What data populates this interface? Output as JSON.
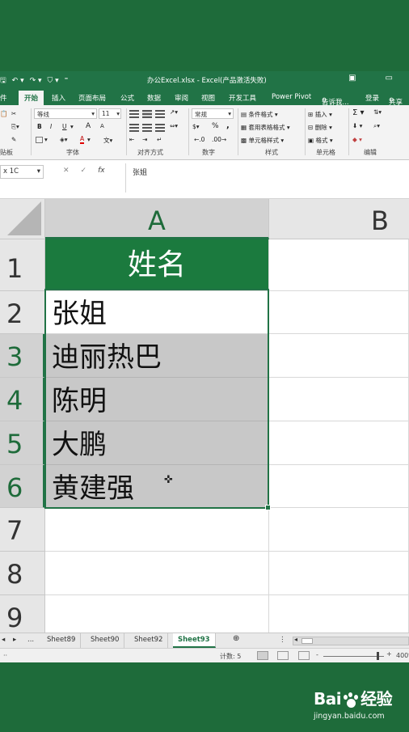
{
  "window": {
    "title": "办公Excel.xlsx - Excel(产品激活失败)",
    "restore_icon": "ribbon-display-icon",
    "minimize_icon": "minimize-icon"
  },
  "ribbon_tabs": [
    {
      "label": "件"
    },
    {
      "label": "开始",
      "active": true
    },
    {
      "label": "插入"
    },
    {
      "label": "页面布局"
    },
    {
      "label": "公式"
    },
    {
      "label": "数据"
    },
    {
      "label": "审阅"
    },
    {
      "label": "视图"
    },
    {
      "label": "开发工具"
    },
    {
      "label": "Power Pivot"
    },
    {
      "label": "告诉我..."
    },
    {
      "label": "登录"
    },
    {
      "label": "共享"
    }
  ],
  "ribbon": {
    "font_name": "等线",
    "font_size": "11",
    "number_format": "常规",
    "bold": "B",
    "italic": "I",
    "underline": "U",
    "grow_font": "A",
    "shrink_font": "A",
    "font_color": "A",
    "currency": "$",
    "percent": "%",
    "comma": ",",
    "conditional_format": "条件格式",
    "format_table": "套用表格格式",
    "cell_styles": "单元格样式",
    "insert": "插入",
    "delete": "删除",
    "format": "格式",
    "groups": {
      "clipboard": "贴板",
      "font": "字体",
      "alignment": "对齐方式",
      "number": "数字",
      "styles": "样式",
      "cells": "单元格",
      "editing": "编辑"
    }
  },
  "formula_bar": {
    "name_box": "x 1C",
    "cancel": "✕",
    "enter": "✓",
    "fx": "fx",
    "content": "张姐"
  },
  "columns": [
    "A",
    "B"
  ],
  "rows": [
    "1",
    "2",
    "3",
    "4",
    "5",
    "6",
    "7",
    "8",
    "9"
  ],
  "cells": {
    "A1": "姓名",
    "A2": "张姐",
    "A3": "迪丽热巴",
    "A4": "陈明",
    "A5": "大鹏",
    "A6": "黄建强"
  },
  "sheets": {
    "nav_prev": "◂",
    "nav_next": "▸",
    "ellipsis": "...",
    "tabs": [
      "Sheet89",
      "Sheet90",
      "Sheet92",
      "Sheet93"
    ],
    "active": "Sheet93",
    "add": "⊕"
  },
  "status": {
    "count": "计数: 5",
    "zoom": "400%",
    "zoom_out": "-",
    "zoom_in": "+"
  },
  "watermark": {
    "brand_left": "Bai",
    "brand_right": "经验",
    "url": "jingyan.baidu.com"
  }
}
